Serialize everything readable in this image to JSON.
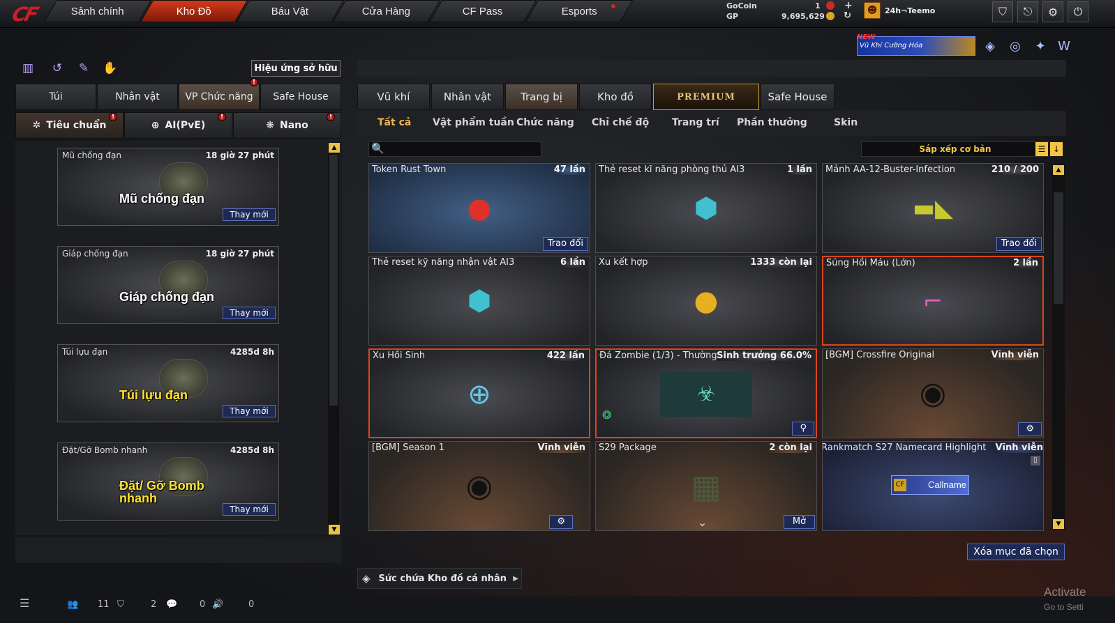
{
  "app": {
    "logo": "CF"
  },
  "nav": [
    {
      "label": "Sảnh chính"
    },
    {
      "label": "Kho Đồ"
    },
    {
      "label": "Báu Vật"
    },
    {
      "label": "Cửa Hàng"
    },
    {
      "label": "CF Pass"
    },
    {
      "label": "Esports"
    }
  ],
  "currency": {
    "gocoin_label": "GoCoin",
    "gocoin_value": "1",
    "gp_label": "GP",
    "gp_value": "9,695,629"
  },
  "user": {
    "name": "24h¬Teemo"
  },
  "banner": {
    "badge": "NEW",
    "text": "Vũ Khí Cường Hóa"
  },
  "left": {
    "effects_button": "Hiệu ứng sở hữu",
    "tabs": [
      {
        "label": "Túi"
      },
      {
        "label": "Nhân vật"
      },
      {
        "label": "VP Chức năng"
      },
      {
        "label": "Safe House"
      }
    ],
    "subtabs": [
      {
        "label": "Tiêu chuẩn"
      },
      {
        "label": "AI(PvE)"
      },
      {
        "label": "Nano"
      }
    ],
    "items": [
      {
        "name": "Mũ chống đạn",
        "time": "18 giờ 27 phút",
        "big": "Mũ chống đạn",
        "action": "Thay mới"
      },
      {
        "name": "Giáp chống đạn",
        "time": "18 giờ 27 phút",
        "big": "Giáp chống đạn",
        "action": "Thay mới"
      },
      {
        "name": "Túi lựu đạn",
        "time": "4285d 8h",
        "big": "Túi lựu đạn",
        "action": "Thay mới"
      },
      {
        "name": "Đặt/Gỡ Bomb nhanh",
        "time": "4285d 8h",
        "big": "Đặt/ Gỡ Bomb nhanh",
        "action": "Thay mới"
      }
    ]
  },
  "right": {
    "tabs": [
      {
        "label": "Vũ khí"
      },
      {
        "label": "Nhân vật"
      },
      {
        "label": "Trang bị"
      },
      {
        "label": "Kho đồ"
      },
      {
        "label": "PREMIUM"
      },
      {
        "label": "Safe House"
      }
    ],
    "subtabs": [
      {
        "label": "Tất cả"
      },
      {
        "label": "Vật phẩm tuần"
      },
      {
        "label": "Chức năng"
      },
      {
        "label": "Chỉ chế độ"
      },
      {
        "label": "Trang trí"
      },
      {
        "label": "Phần thưởng"
      },
      {
        "label": "Skin"
      }
    ],
    "search_placeholder": "",
    "sort_label": "Sắp xếp cơ bản",
    "cards": [
      {
        "name": "Token Rust Town",
        "count": "47 lần",
        "action": "Trao đổi"
      },
      {
        "name": "Thẻ reset kĩ năng phòng thủ AI3",
        "count": "1 lần",
        "action": ""
      },
      {
        "name": "Mảnh AA-12-Buster-Infection",
        "count": "210 / 200",
        "action": "Trao đổi"
      },
      {
        "name": "Thẻ reset kỹ năng nhận vật AI3",
        "count": "6 lần",
        "action": ""
      },
      {
        "name": "Xu kết hợp",
        "count": "1333 còn lại",
        "action": ""
      },
      {
        "name": "Súng Hồi Máu (Lớn)",
        "count": "2 lần",
        "action": ""
      },
      {
        "name": "Xu Hồi Sinh",
        "count": "422 lần",
        "action": ""
      },
      {
        "name": "Đá Zombie (1/3) - Thường",
        "count": "Sinh trưởng 66.0%",
        "action": ""
      },
      {
        "name": "[BGM] Crossfire Original",
        "count": "Vĩnh viễn",
        "action": ""
      },
      {
        "name": "[BGM] Season 1",
        "count": "Vĩnh viễn",
        "action": ""
      },
      {
        "name": "S29 Package",
        "count": "2 còn lại",
        "action": "Mở"
      },
      {
        "name": "Rankmatch S27 Namecard Highlight",
        "count": "Vĩnh viễn",
        "action": "",
        "card_text": "Callname"
      }
    ],
    "delete_button": "Xóa mục đã chọn",
    "capacity_label": "Sức chứa Kho đồ cá nhân"
  },
  "status": {
    "a": "11",
    "b": "2",
    "c": "0",
    "d": "0"
  },
  "watermark": {
    "line1": "Activate",
    "line2": "Go to Setti"
  },
  "colors": {
    "accent": "#d33a1a",
    "highlight": "#f0b35a",
    "button_blue": "#1e2a55"
  }
}
